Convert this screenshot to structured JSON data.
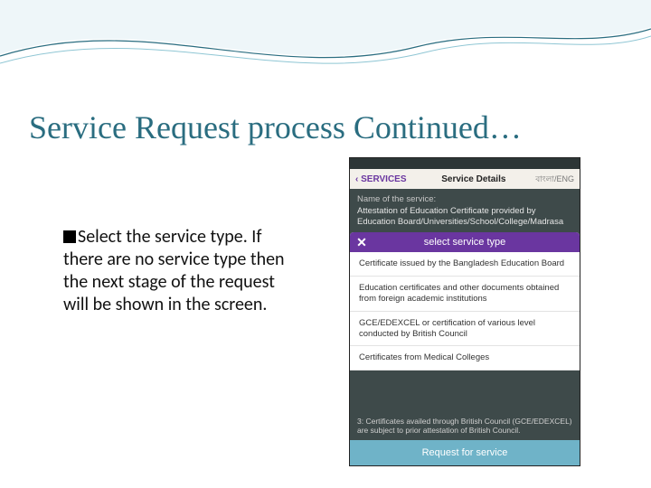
{
  "title": "Service Request process Continued…",
  "body": "Select the service type. If there are no service type then the next stage of the request will be shown in the screen.",
  "phone": {
    "back": "SERVICES",
    "navTitle": "Service Details",
    "lang": "বাংলা/ENG",
    "sectionLabel": "Name of the service:",
    "serviceName": "Attestation of Education Certificate provided by Education Board/Universities/School/College/Madrasa",
    "modalTitle": "select service type",
    "options": [
      "Certificate issued by the Bangladesh Education Board",
      "Education certificates and other documents obtained from foreign academic institutions",
      "GCE/EDEXCEL or certification of various level conducted by British Council",
      "Certificates from Medical Colleges"
    ],
    "footNote": "3:  Certificates availed through British Council (GCE/EDEXCEL) are subject to prior attestation of British Council.",
    "requestBtn": "Request for service"
  }
}
